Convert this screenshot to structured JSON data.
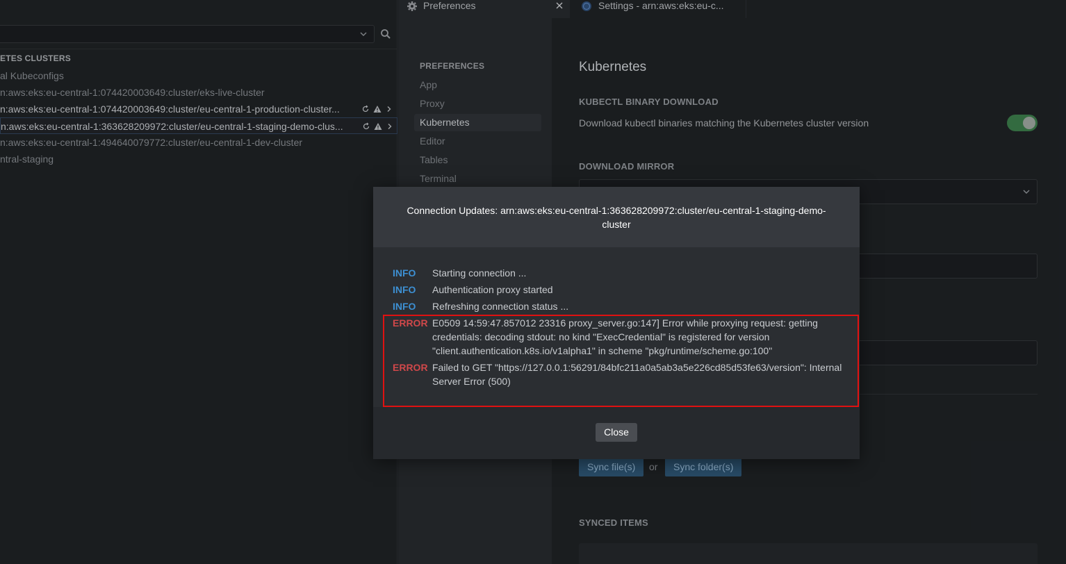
{
  "left_panel": {
    "search": {
      "value": "",
      "placeholder": ""
    },
    "section_title": "ETES CLUSTERS",
    "items": [
      {
        "label": "al Kubeconfigs"
      },
      {
        "label": "n:aws:eks:eu-central-1:074420003649:cluster/eks-live-cluster"
      },
      {
        "label": "n:aws:eks:eu-central-1:074420003649:cluster/eu-central-1-production-cluster..."
      },
      {
        "label": "n:aws:eks:eu-central-1:363628209972:cluster/eu-central-1-staging-demo-clus..."
      },
      {
        "label": "n:aws:eks:eu-central-1:494640079772:cluster/eu-central-1-dev-cluster"
      },
      {
        "label": "ntral-staging"
      }
    ]
  },
  "tabs": [
    {
      "label": "Preferences"
    },
    {
      "label": "Settings - arn:aws:eks:eu-c..."
    }
  ],
  "preferences_nav": {
    "title": "PREFERENCES",
    "items": [
      {
        "label": "App"
      },
      {
        "label": "Proxy"
      },
      {
        "label": "Kubernetes"
      },
      {
        "label": "Editor"
      },
      {
        "label": "Tables"
      },
      {
        "label": "Terminal"
      }
    ]
  },
  "settings": {
    "heading": "Kubernetes",
    "kubectl_section": "KUBECTL BINARY DOWNLOAD",
    "kubectl_desc": "Download kubectl binaries matching the Kubernetes cluster version",
    "kubectl_enabled": true,
    "mirror_section": "DOWNLOAD MIRROR",
    "sync_files_label": "Sync file(s)",
    "or_label": "or",
    "sync_folder_label": "Sync folder(s)",
    "synced_section": "SYNCED ITEMS"
  },
  "dialog": {
    "title": "Connection Updates: arn:aws:eks:eu-central-1:363628209972:cluster/eu-central-1-staging-demo-cluster",
    "logs": [
      {
        "level": "INFO",
        "message": "Starting connection ..."
      },
      {
        "level": "INFO",
        "message": "Authentication proxy started"
      },
      {
        "level": "INFO",
        "message": "Refreshing connection status ..."
      },
      {
        "level": "ERROR",
        "message": "E0509 14:59:47.857012 23316 proxy_server.go:147] Error while proxying request: getting credentials: decoding stdout: no kind \"ExecCredential\" is registered for version \"client.authentication.k8s.io/v1alpha1\" in scheme \"pkg/runtime/scheme.go:100\""
      },
      {
        "level": "ERROR",
        "message": "Failed to GET \"https://127.0.0.1:56291/84bfc211a0a5ab3a5e226cd85d53fe63/version\": Internal Server Error (500)"
      }
    ],
    "close_label": "Close"
  },
  "colors": {
    "info": "#3d90d3",
    "error": "#d0484a",
    "highlight_border": "#e01111",
    "toggle_on": "#3b7a49",
    "sync_button": "#2e5675"
  }
}
